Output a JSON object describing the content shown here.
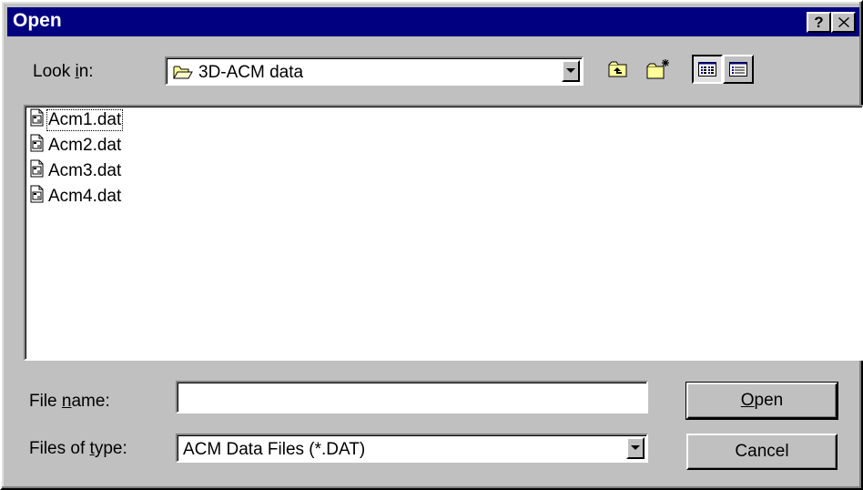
{
  "window": {
    "title": "Open",
    "help_button": "?",
    "close_button": "✕"
  },
  "look_in": {
    "label_prefix": "Look ",
    "label_accel": "i",
    "label_suffix": "n:",
    "value": "3D-ACM data",
    "icon": "open-folder-icon"
  },
  "toolbar": {
    "buttons": [
      {
        "name": "up-one-level",
        "icon": "up-folder-icon"
      },
      {
        "name": "create-new-folder",
        "icon": "new-folder-icon"
      },
      {
        "name": "list-view",
        "icon": "list-view-icon",
        "pressed": true
      },
      {
        "name": "details-view",
        "icon": "details-view-icon",
        "pressed": false
      }
    ]
  },
  "files": [
    {
      "name": "Acm1.dat",
      "icon": "data-file-icon"
    },
    {
      "name": "Acm2.dat",
      "icon": "data-file-icon"
    },
    {
      "name": "Acm3.dat",
      "icon": "data-file-icon"
    },
    {
      "name": "Acm4.dat",
      "icon": "data-file-icon"
    }
  ],
  "file_name": {
    "label_prefix": "File ",
    "label_accel": "n",
    "label_suffix": "ame:",
    "value": ""
  },
  "files_of_type": {
    "label_prefix": "Files of ",
    "label_accel": "t",
    "label_suffix": "ype:",
    "value": "ACM Data Files (*.DAT)"
  },
  "buttons": {
    "open_accel": "O",
    "open_rest": "pen",
    "cancel": "Cancel"
  },
  "colors": {
    "title_bar": "#000080",
    "face": "#c0c0c0",
    "window_bg": "#ffffff"
  }
}
